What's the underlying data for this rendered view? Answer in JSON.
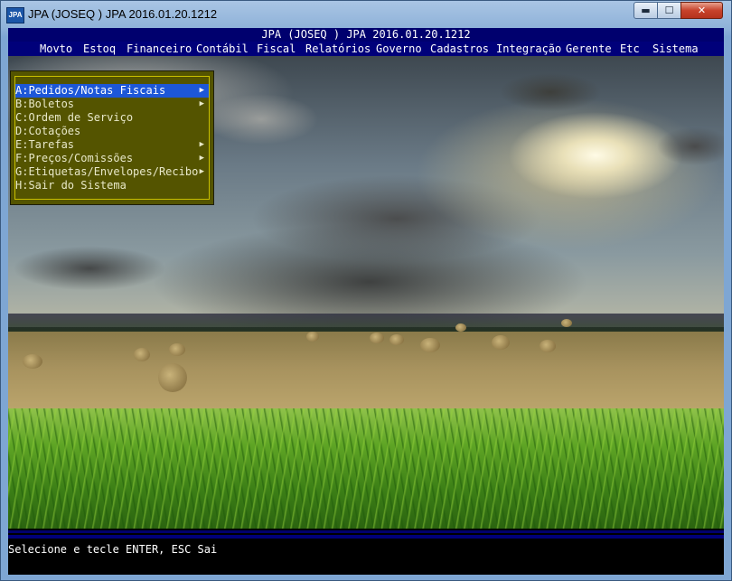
{
  "window": {
    "title": "JPA (JOSEQ ) JPA 2016.01.20.1212",
    "icon_name": "jpa-app-icon",
    "icon_text": "JPA",
    "buttons": {
      "minimize": "▬",
      "maximize": "☐",
      "close": "✕"
    }
  },
  "header": {
    "title": "JPA (JOSEQ ) JPA 2016.01.20.1212"
  },
  "menubar": {
    "items": [
      "Movto",
      "Estoq",
      "Financeiro",
      "Contábil",
      "Fiscal",
      "Relatórios",
      "Governo",
      "Cadastros",
      "Integração",
      "Gerente",
      "Etc",
      "Sistema"
    ],
    "active": "Movto"
  },
  "popup": {
    "items": [
      {
        "label": "A:Pedidos/Notas Fiscais",
        "submenu": true,
        "selected": true
      },
      {
        "label": "B:Boletos",
        "submenu": true,
        "selected": false
      },
      {
        "label": "C:Ordem de Serviço",
        "submenu": false,
        "selected": false
      },
      {
        "label": "D:Cotações",
        "submenu": false,
        "selected": false
      },
      {
        "label": "E:Tarefas",
        "submenu": true,
        "selected": false
      },
      {
        "label": "F:Preços/Comissões",
        "submenu": true,
        "selected": false
      },
      {
        "label": "G:Etiquetas/Envelopes/Recibo",
        "submenu": true,
        "selected": false
      },
      {
        "label": "H:Sair do Sistema",
        "submenu": false,
        "selected": false
      }
    ],
    "submenu_glyph": "▶"
  },
  "status": {
    "text": "Selecione e tecle ENTER, ESC Sai"
  },
  "colors": {
    "header_bg": "#00006e",
    "menubar_bg": "#00007a",
    "popup_bg": "#545400",
    "popup_border": "#c9c000",
    "selection": "#1d57d8"
  }
}
